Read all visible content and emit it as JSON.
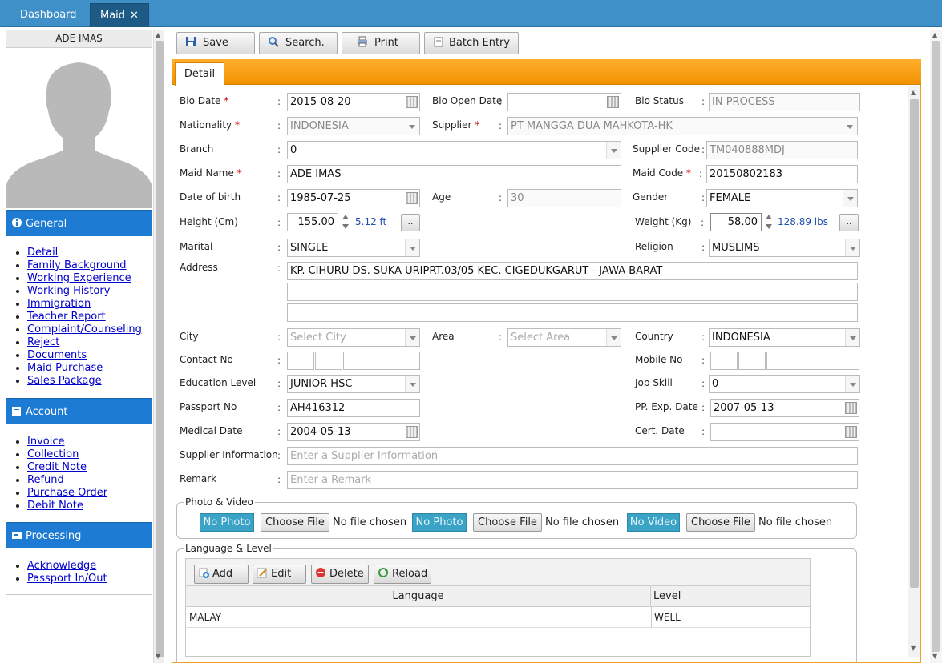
{
  "tabs": {
    "dashboard": "Dashboard",
    "maid": "Maid",
    "close": "✕"
  },
  "sidebar": {
    "name": "ADE IMAS",
    "sections": {
      "general": {
        "title": "General",
        "items": [
          "Detail",
          "Family Background",
          "Working Experience",
          "Working History",
          "Immigration",
          "Teacher Report",
          "Complaint/Counseling",
          "Reject",
          "Documents",
          "Maid Purchase",
          "Sales Package"
        ]
      },
      "account": {
        "title": "Account",
        "items": [
          "Invoice",
          "Collection",
          "Credit Note",
          "Refund",
          "Purchase Order",
          "Debit Note"
        ]
      },
      "processing": {
        "title": "Processing",
        "items": [
          "Acknowledge",
          "Passport In/Out"
        ]
      }
    }
  },
  "toolbar": {
    "save": "Save",
    "search": "Search.",
    "print": "Print",
    "batch": "Batch Entry"
  },
  "detail_tab": "Detail",
  "form": {
    "bio_date_label": "Bio Date",
    "bio_date": "2015-08-20",
    "bio_open_label": "Bio Open Date",
    "bio_open": "",
    "bio_status_label": "Bio Status",
    "bio_status": "IN PROCESS",
    "nationality_label": "Nationality",
    "nationality": "INDONESIA",
    "supplier_label": "Supplier",
    "supplier": "PT MANGGA DUA MAHKOTA-HK",
    "branch_label": "Branch",
    "branch": "0",
    "supplier_code_label": "Supplier Code",
    "supplier_code": "TM040888MDJ",
    "maid_name_label": "Maid Name",
    "maid_name": "ADE IMAS",
    "maid_code_label": "Maid Code",
    "maid_code": "20150802183",
    "dob_label": "Date of birth",
    "dob": "1985-07-25",
    "age_label": "Age",
    "age": "30",
    "gender_label": "Gender",
    "gender": "FEMALE",
    "height_label": "Height (Cm)",
    "height": "155.00",
    "height_ft": "5.12 ft",
    "weight_label": "Weight (Kg)",
    "weight": "58.00",
    "weight_lbs": "128.89 lbs",
    "marital_label": "Marital",
    "marital": "SINGLE",
    "religion_label": "Religion",
    "religion": "MUSLIMS",
    "address_label": "Address",
    "address1": "KP. CIHURU DS. SUKA URIPRT.03/05 KEC. CIGEDUKGARUT - JAWA BARAT",
    "address2": "",
    "address3": "",
    "city_label": "City",
    "city_ph": "Select City",
    "area_label": "Area",
    "area_ph": "Select Area",
    "country_label": "Country",
    "country": "INDONESIA",
    "contact_label": "Contact No",
    "mobile_label": "Mobile No",
    "education_label": "Education Level",
    "education": "JUNIOR HSC",
    "jobskill_label": "Job Skill",
    "jobskill": "0",
    "passport_label": "Passport No",
    "passport": "AH416312",
    "ppexp_label": "PP. Exp. Date",
    "ppexp": "2007-05-13",
    "medical_label": "Medical Date",
    "medical": "2004-05-13",
    "cert_label": "Cert. Date",
    "cert": "",
    "supinfo_label": "Supplier Information",
    "supinfo_ph": "Enter a Supplier Information",
    "remark_label": "Remark",
    "remark_ph": "Enter a Remark",
    "ellipsis": "..",
    "colon": ":",
    "req": "*"
  },
  "media": {
    "legend": "Photo & Video",
    "no_photo": "No Photo",
    "no_video": "No Video",
    "choose": "Choose File",
    "nofile": "No file chosen"
  },
  "language": {
    "legend": "Language & Level",
    "buttons": {
      "add": "Add",
      "edit": "Edit",
      "delete": "Delete",
      "reload": "Reload"
    },
    "headers": {
      "language": "Language",
      "level": "Level"
    },
    "rows": [
      {
        "language": "MALAY",
        "level": "WELL"
      }
    ]
  }
}
